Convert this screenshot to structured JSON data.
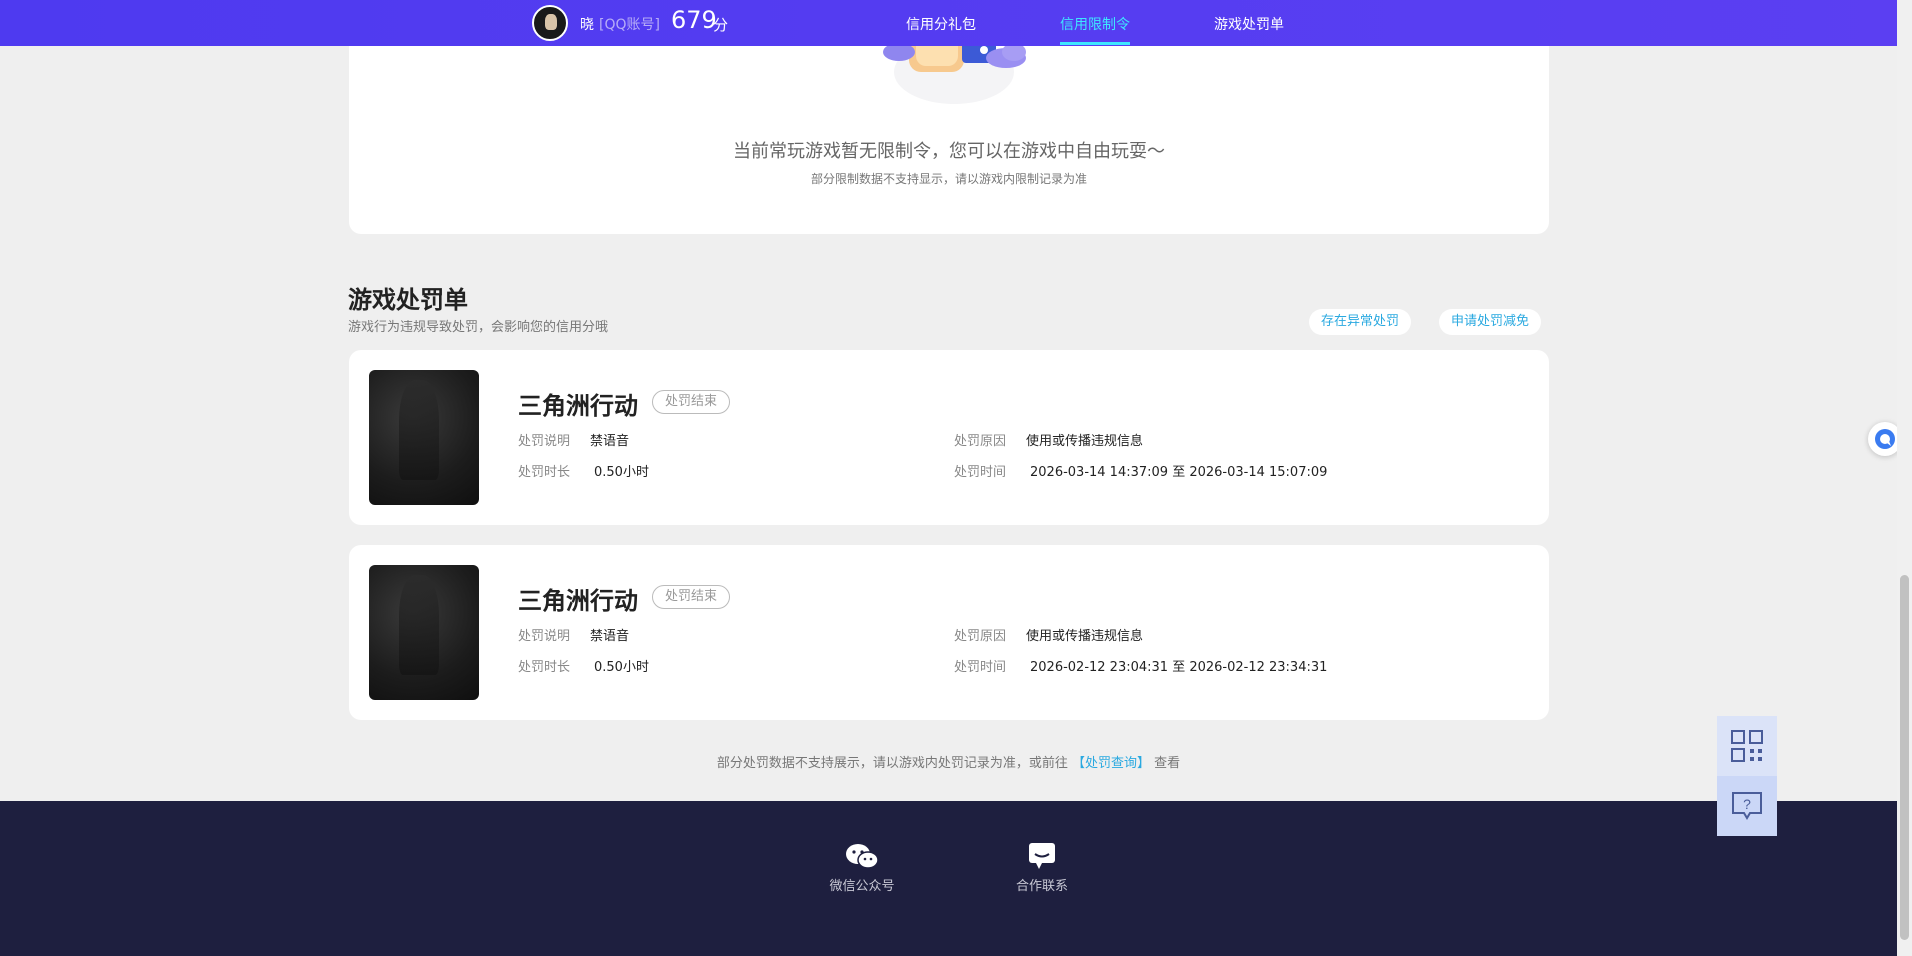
{
  "header": {
    "user_name": "晓",
    "account_type": "[QQ账号]",
    "score": "679",
    "score_unit": "分",
    "tabs": [
      {
        "label": "信用分礼包",
        "active": false
      },
      {
        "label": "信用限制令",
        "active": true
      },
      {
        "label": "游戏处罚单",
        "active": false
      }
    ],
    "accent_color": "#3ee7ff",
    "bar_color": "#5a3df0"
  },
  "restriction": {
    "empty_message": "当前常玩游戏暂无限制令，您可以在游戏中自由玩耍～",
    "empty_note": "部分限制数据不支持显示，请以游戏内限制记录为准"
  },
  "penalties": {
    "title": "游戏处罚单",
    "description": "游戏行为违规导致处罚，会影响您的信用分哦",
    "btn_abnormal": "存在异常处罚",
    "btn_appeal": "申请处罚减免",
    "labels": {
      "desc": "处罚说明",
      "duration": "处罚时长",
      "reason": "处罚原因",
      "time": "处罚时间"
    },
    "items": [
      {
        "game": "三角洲行动",
        "status": "处罚结束",
        "desc": "禁语音",
        "duration": "0.50小时",
        "reason": "使用或传播违规信息",
        "time": "2026-03-14 14:37:09 至 2026-03-14 15:07:09"
      },
      {
        "game": "三角洲行动",
        "status": "处罚结束",
        "desc": "禁语音",
        "duration": "0.50小时",
        "reason": "使用或传播违规信息",
        "time": "2026-02-12 23:04:31 至 2026-02-12 23:34:31"
      }
    ],
    "bottom_note_prefix": "部分处罚数据不支持展示，请以游戏内处罚记录为准，或前往",
    "bottom_note_link": "【处罚查询】",
    "bottom_note_suffix": "查看"
  },
  "footer": {
    "wechat_label": "微信公众号",
    "contact_label": "合作联系"
  },
  "icons": {
    "qr": "qr-code-icon",
    "help": "question-icon",
    "chat": "chat-icon",
    "wechat": "wechat-icon",
    "message": "message-icon"
  }
}
